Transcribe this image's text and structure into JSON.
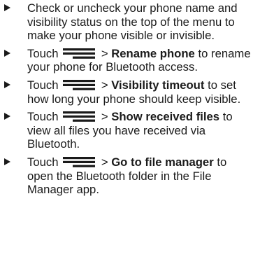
{
  "bullets": [
    {
      "text": "Check or uncheck your phone name and visibility status on the top of the menu to make your phone visible or invisible."
    },
    {
      "prefix": "Touch",
      "icon": "menu-icon",
      "sep": ">",
      "bold": "Rename phone",
      "suffix": "to rename your phone for Bluetooth access."
    },
    {
      "prefix": "Touch",
      "icon": "menu-icon",
      "sep": ">",
      "bold": "Visibility timeout",
      "suffix": "to set how long your phone should keep visible."
    },
    {
      "prefix": "Touch",
      "icon": "menu-icon",
      "sep": ">",
      "bold": "Show received files",
      "suffix": "to view all files you have received via Bluetooth."
    },
    {
      "prefix": "Touch",
      "icon": "menu-icon",
      "sep": ">",
      "bold": "Go to file manager",
      "suffix": "to open the Bluetooth folder in the File Manager app."
    }
  ]
}
